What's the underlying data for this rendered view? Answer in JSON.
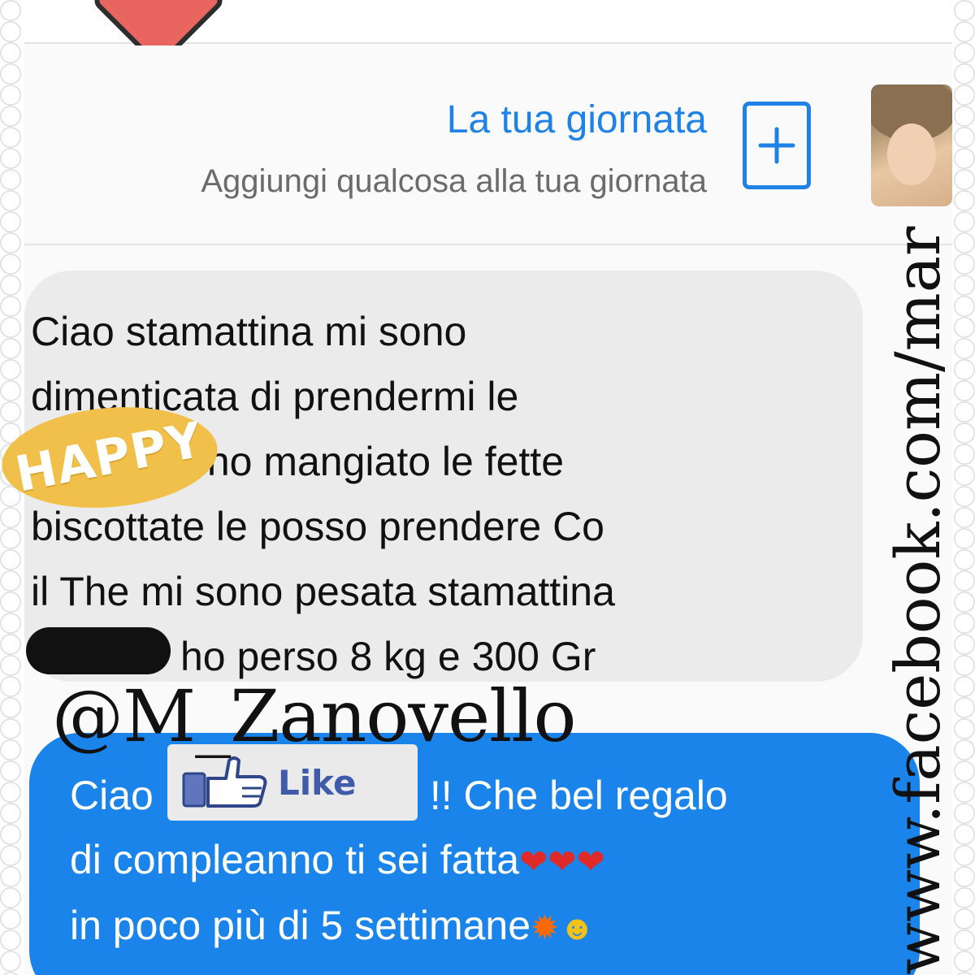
{
  "header": {
    "badge_icon": "heart-icon",
    "badge_color": "#e8665f"
  },
  "day_section": {
    "title": "La tua giornata",
    "subtitle": "Aggiungi qualcosa alla tua giornata",
    "add_icon": "plus-icon",
    "accent_color": "#1f82e6"
  },
  "messages": {
    "incoming": {
      "lines": [
        "Ciao stamattina mi sono",
        "dimenticata di prendermi le",
        "bustine e ho mangiato le fette",
        "biscottate  le posso prendere Co",
        "il The mi sono pesata stamattina",
        "ho perso 8 kg e 300 Gr"
      ],
      "bubble_color": "#ebebeb"
    },
    "outgoing": {
      "line1_start": "Ciao",
      "line1_end": "!! Che bel regalo",
      "line2": "di compleanno ti sei fatta",
      "line2_emojis": "❤❤❤",
      "line3": "in poco più di 5 settimane",
      "line3_emoji_1": "✹",
      "line3_emoji_2": "☻",
      "bubble_color": "#1b84ea"
    }
  },
  "overlays": {
    "happy_sticker": "HAPPY",
    "like_badge": "Like",
    "like_icon": "thumbs-up-icon",
    "handle": "@M_Zanovello",
    "url": "www.facebook.com/mar"
  }
}
